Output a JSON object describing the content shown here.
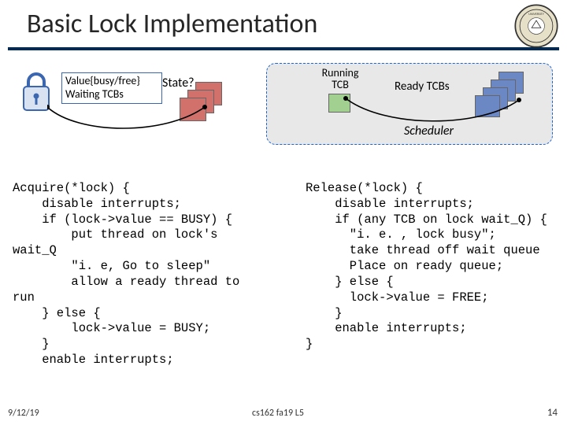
{
  "title": "Basic Lock Implementation",
  "lock_box": {
    "line1": "Value{busy/free}",
    "line2": "Waiting TCBs"
  },
  "state_label": "State?",
  "scheduler": {
    "running": "Running\nTCB",
    "ready": "Ready TCBs",
    "label": "Scheduler"
  },
  "code_acquire": "Acquire(*lock) {\n    disable interrupts;\n    if (lock->value == BUSY) {\n        put thread on lock's\nwait_Q\n        \"i. e, Go to sleep\"\n        allow a ready thread to\nrun\n    } else {\n        lock->value = BUSY;\n    }\n    enable interrupts;",
  "code_release": "Release(*lock) {\n    disable interrupts;\n    if (any TCB on lock wait_Q) {\n      \"i. e. , lock busy\";\n      take thread off wait queue\n      Place on ready queue;\n    } else {\n      lock->value = FREE;\n    }\n    enable interrupts;\n}",
  "footer": {
    "date": "9/12/19",
    "center": "cs162 fa19 L5",
    "page": "14"
  }
}
